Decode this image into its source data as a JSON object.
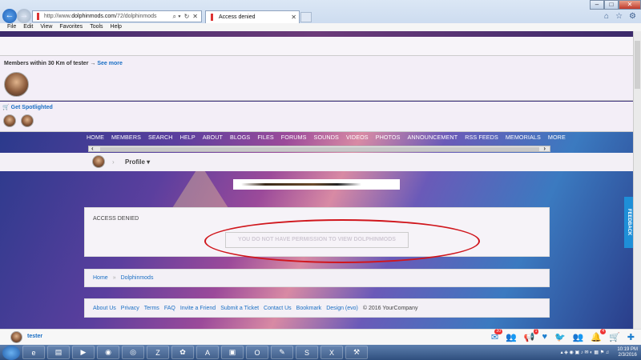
{
  "browser": {
    "address": {
      "prefix": "http://www.",
      "domain": "dolphinmods.com",
      "path": "/72/dolphinmods"
    },
    "tab_title": "Access denied",
    "menu": [
      "File",
      "Edit",
      "View",
      "Favorites",
      "Tools",
      "Help"
    ]
  },
  "members": {
    "label": "Members within 30 Km of tester",
    "arrow": "→",
    "see_more": "See more"
  },
  "spotlight": {
    "label": "Get Spotlighted",
    "icon": "🛒"
  },
  "nav": [
    "HOME",
    "MEMBERS",
    "SEARCH",
    "HELP",
    "ABOUT",
    "BLOGS",
    "FILES",
    "FORUMS",
    "SOUNDS",
    "VIDEOS",
    "PHOTOS",
    "ANNOUNCEMENT",
    "RSS FEEDS",
    "MEMORIALS",
    "MORE"
  ],
  "profile": {
    "label": "Profile",
    "chevron": "▾",
    "sep": "›"
  },
  "access": {
    "heading": "ACCESS DENIED",
    "message": "YOU DO NOT HAVE PERMISSION TO VIEW DOLPHINMODS"
  },
  "breadcrumb": {
    "home": "Home",
    "sep": "»",
    "current": "Dolphinmods"
  },
  "footer": {
    "links": [
      "About Us",
      "Privacy",
      "Terms",
      "FAQ",
      "Invite a Friend",
      "Submit a Ticket",
      "Contact Us",
      "Bookmark",
      "Design (evo)"
    ],
    "copyright": "© 2016 YourCompany"
  },
  "feedback": "FEEDBACK",
  "bottombar": {
    "user": "tester",
    "badges": {
      "messages": "20",
      "friends": "",
      "notifications": "1",
      "alerts": "4"
    }
  },
  "clock": {
    "time": "10:19 PM",
    "date": "2/3/2016"
  },
  "colors": {
    "accent": "#1a6fc4",
    "highlight_ring": "#d0161c",
    "feedback": "#1e8fd8"
  }
}
